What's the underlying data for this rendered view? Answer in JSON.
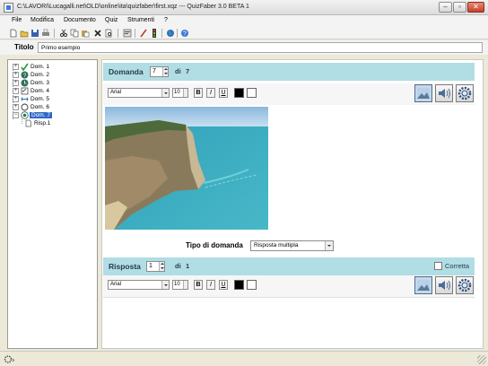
{
  "window": {
    "title": "C:\\LAVORI\\Lucagalli.net\\OLD\\online\\ita\\quizfaber\\first.xqz  ---  QuizFaber 3.0 BETA 1"
  },
  "menu": [
    "File",
    "Modifica",
    "Documento",
    "Quiz",
    "Strumenti",
    "?"
  ],
  "titolo": {
    "label": "Titolo",
    "value": "Primo esempio"
  },
  "tree": {
    "items": [
      {
        "label": "Dom. 1",
        "icon": "check-icon"
      },
      {
        "label": "Dom. 2",
        "icon": "question-icon"
      },
      {
        "label": "Dom. 3",
        "icon": "clock-icon"
      },
      {
        "label": "Dom. 4",
        "icon": "checklist-icon"
      },
      {
        "label": "Dom. 5",
        "icon": "arrows-icon"
      },
      {
        "label": "Dom. 6",
        "icon": "circle-icon"
      },
      {
        "label": "Dom. 7",
        "icon": "radio-icon",
        "selected": true
      },
      {
        "label": "Risp.1",
        "icon": "document-icon",
        "child": true
      }
    ]
  },
  "domanda": {
    "label": "Domanda",
    "number": "7",
    "di": "di",
    "total": "7"
  },
  "format": {
    "font": "Arial",
    "size": "10",
    "bold": "B",
    "italic": "I",
    "underline": "U"
  },
  "tipo": {
    "label": "Tipo di domanda",
    "value": "Risposta multipla"
  },
  "risposta": {
    "label": "Risposta",
    "number": "1",
    "di": "di",
    "total": "1",
    "corretta": "Corretta"
  },
  "colors": {
    "band": "#b1dde4",
    "selection": "#3169c6"
  }
}
